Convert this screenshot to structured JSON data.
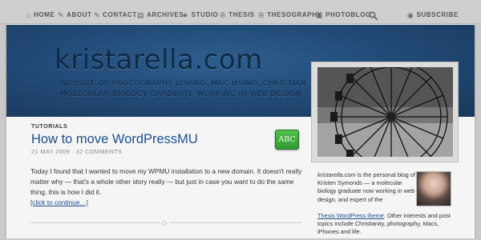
{
  "nav": {
    "items": [
      {
        "label": "HOME",
        "icon": "home-icon",
        "glyph": "⌂"
      },
      {
        "label": "ABOUT",
        "icon": "tag-icon",
        "glyph": "✎"
      },
      {
        "label": "CONTACT",
        "icon": "pencil-icon",
        "glyph": "✎"
      },
      {
        "label": "ARCHIVES",
        "icon": "document-icon",
        "glyph": "▤"
      },
      {
        "label": "STUDIO",
        "icon": "star-icon",
        "glyph": "★"
      },
      {
        "label": "THESIS",
        "icon": "wrench-icon",
        "glyph": "✇"
      },
      {
        "label": "THESOGRAPHY",
        "icon": "wrench-icon",
        "glyph": "✇"
      },
      {
        "label": "PHOTOBLOG",
        "icon": "camera-icon",
        "glyph": "▣"
      },
      {
        "label": "SUBSCRIBE",
        "icon": "rss-icon",
        "glyph": "◉"
      }
    ],
    "search_icon": "search-icon"
  },
  "header": {
    "site_title": "kristarella.com",
    "tagline": "WEBSITE OF PHOTOGRAPHY LOVING, MAC-USING, CHRISTIAN MOLECULAR BIOLOGY GRADUATE WORKING IN WEB DESIGN",
    "color": "#1d4572"
  },
  "post": {
    "category": "TUTORIALS",
    "title": "How to move WordPressMU",
    "meta": "21 MAY 2009 · 32 COMMENTS",
    "badge": "ABC",
    "body": "Today I found that I wanted to move my WPMU installation to a new domain. It doesn't really matter why — that's a whole other story really — but just in case you want to do the same thing, this is how I did it.",
    "read_more": "[click to continue…]"
  },
  "sidebar": {
    "bio_site": "kristarella.com",
    "bio_text_1": " is the personal blog of Kristen Symonds — a molecular biology graduate now working in web design, and expert of the ",
    "bio_link": "Thesis WordPress theme",
    "bio_text_2": ". Other interests and post topics include Christianity, photography, Macs, iPhones and life."
  },
  "colors": {
    "link": "#1e4f8a",
    "badge_green": "#3aa63b",
    "nav_bg": "#cfcfcf"
  }
}
